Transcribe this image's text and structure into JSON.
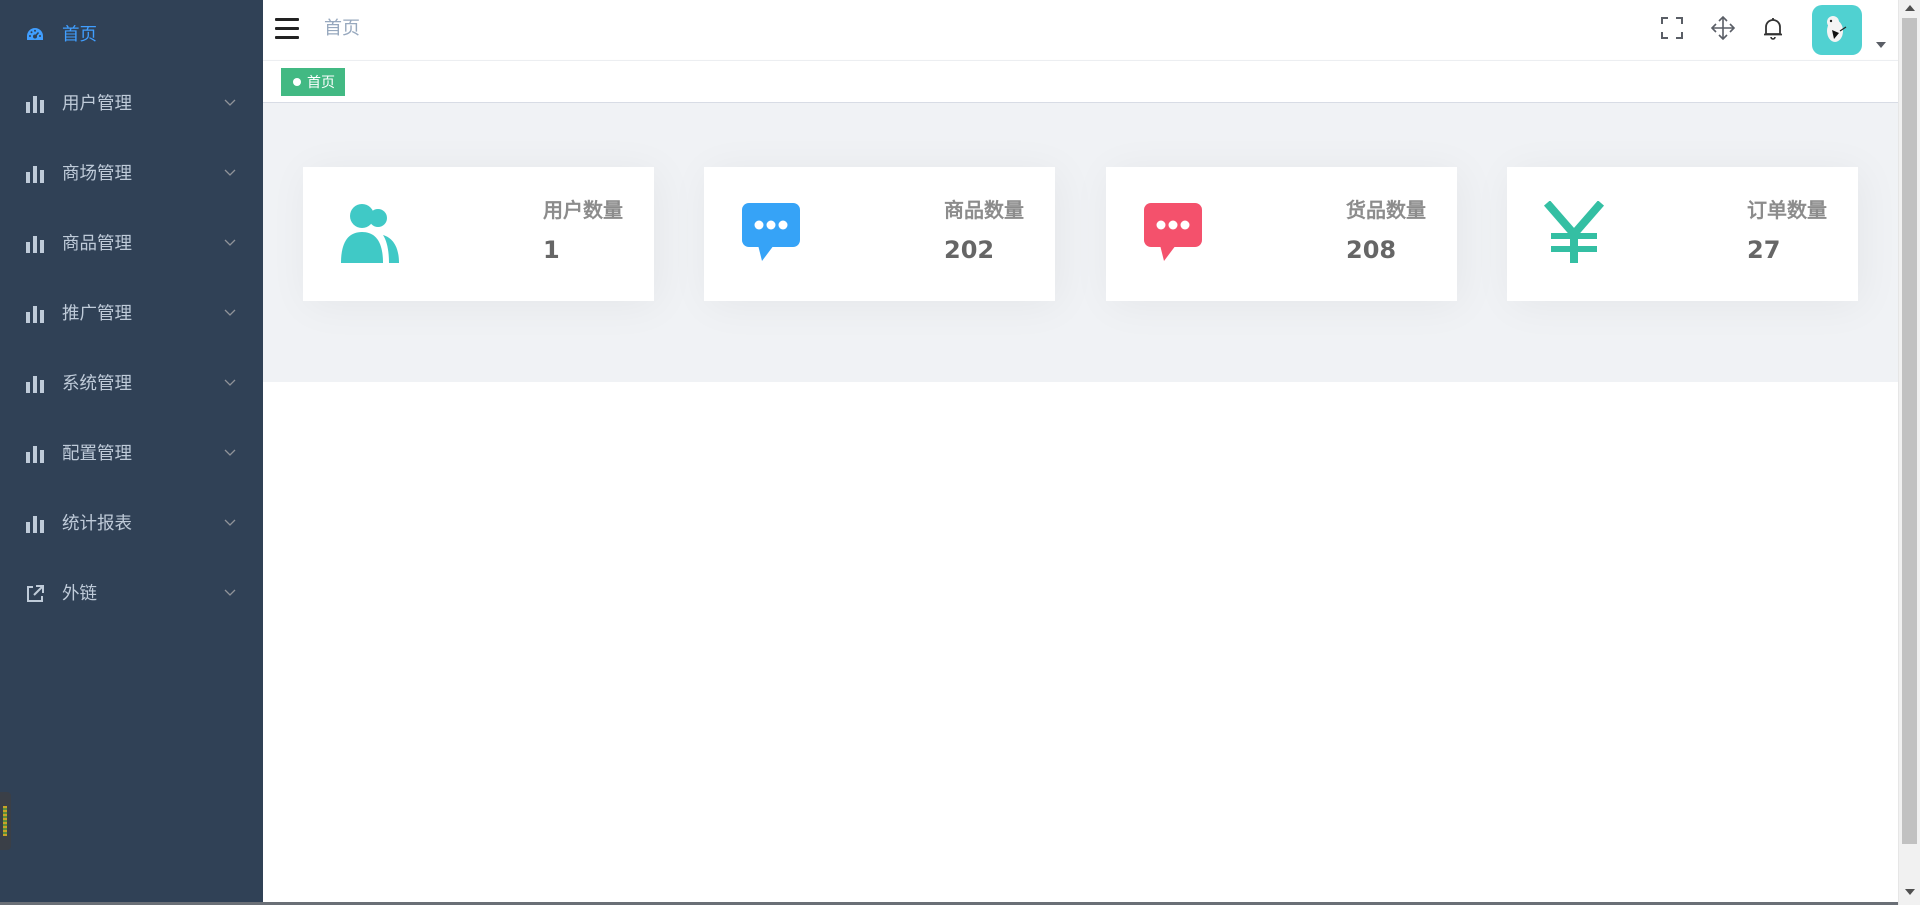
{
  "colors": {
    "sidebar_bg": "#304156",
    "sidebar_text": "#bfcbd9",
    "active_text": "#409eff",
    "tag_bg": "#42b983",
    "content_bg": "#f0f2f5",
    "card_users_icon": "#40c9c6",
    "card_goods_icon": "#36a3f7",
    "card_products_icon": "#f4516c",
    "card_orders_icon": "#34bfa3"
  },
  "sidebar": {
    "items": [
      {
        "label": "首页",
        "icon": "dashboard-icon",
        "active": true,
        "has_arrow": false
      },
      {
        "label": "用户管理",
        "icon": "bar-chart-icon",
        "active": false,
        "has_arrow": true
      },
      {
        "label": "商场管理",
        "icon": "bar-chart-icon",
        "active": false,
        "has_arrow": true
      },
      {
        "label": "商品管理",
        "icon": "bar-chart-icon",
        "active": false,
        "has_arrow": true
      },
      {
        "label": "推广管理",
        "icon": "bar-chart-icon",
        "active": false,
        "has_arrow": true
      },
      {
        "label": "系统管理",
        "icon": "bar-chart-icon",
        "active": false,
        "has_arrow": true
      },
      {
        "label": "配置管理",
        "icon": "bar-chart-icon",
        "active": false,
        "has_arrow": true
      },
      {
        "label": "统计报表",
        "icon": "bar-chart-icon",
        "active": false,
        "has_arrow": true
      },
      {
        "label": "外链",
        "icon": "external-link-icon",
        "active": false,
        "has_arrow": true
      }
    ]
  },
  "header": {
    "breadcrumb": "首页",
    "icons": [
      "fullscreen-icon",
      "size-move-icon",
      "bell-icon"
    ]
  },
  "tags": {
    "items": [
      {
        "label": "首页",
        "active": true
      }
    ]
  },
  "cards": [
    {
      "label": "用户数量",
      "value": "1",
      "icon": "users-icon"
    },
    {
      "label": "商品数量",
      "value": "202",
      "icon": "chat-bubble-icon"
    },
    {
      "label": "货品数量",
      "value": "208",
      "icon": "chat-bubble-icon"
    },
    {
      "label": "订单数量",
      "value": "27",
      "icon": "yen-icon"
    }
  ]
}
